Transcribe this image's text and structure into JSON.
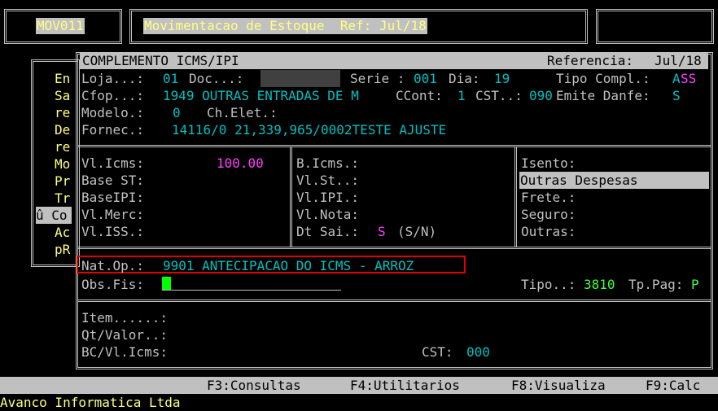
{
  "top": {
    "program_code": "MOV011",
    "title": "Movimentacao de Estoque  Ref: Jul/18"
  },
  "menu": {
    "items": [
      "En",
      "Sa",
      "re",
      "De",
      "re",
      "Mo",
      "Pr",
      "Tr",
      "û Co",
      "Ac",
      "pR"
    ],
    "selected_index": 8
  },
  "panel": {
    "title": "COMPLEMENTO ICMS/IPI",
    "referencia_label": "Referencia:",
    "referencia_value": "Jul/18",
    "loja_label": "Loja...:",
    "loja_value": "01",
    "doc_label": "Doc...:",
    "doc_value": "",
    "serie_label": "Serie :",
    "serie_value": "001",
    "dia_label": "Dia:",
    "dia_value": "19",
    "tipo_compl_label": "Tipo Compl.:",
    "tipo_compl_value_a": "A",
    "tipo_compl_value_b": "SS",
    "cfop_label": "Cfop...:",
    "cfop_value": "1949 OUTRAS ENTRADAS DE M",
    "ccont_label": "CCont:",
    "ccont_value": "1",
    "cst_label": "CST..:",
    "cst_value": "090",
    "emite_label": "Emite Danfe:",
    "emite_value": "S",
    "modelo_label": "Modelo.:",
    "modelo_value": "0",
    "chelet_label": "Ch.Elet.:",
    "fornec_label": "Fornec.:",
    "fornec_value": "14116/0 21,339,965/0002TESTE AJUSTE",
    "col1": {
      "vl_icms_label": "Vl.Icms:",
      "vl_icms_value": "100.00",
      "base_st_label": "Base ST:",
      "baseipi_label": "BaseIPI:",
      "vl_merc_label": "Vl.Merc:",
      "vl_iss_label": "Vl.ISS.:"
    },
    "col2": {
      "b_icms_label": "B.Icms.:",
      "vl_st_label": "Vl.St..:",
      "vl_ipi_label": "Vl.IPI.:",
      "vl_nota_label": "Vl.Nota:",
      "dt_sai_label": "Dt Sai.:",
      "dt_sai_value": "S",
      "dt_sai_hint": "(S/N)"
    },
    "col3": {
      "isento_label": "Isento:",
      "outras_despesas_label": "Outras Despesas",
      "frete_label": "Frete.:",
      "seguro_label": "Seguro:",
      "outras_label": "Outras:"
    },
    "natop_label": "Nat.Op.:",
    "natop_value": "9901 ANTECIPACAO DO ICMS - ARROZ",
    "obs_label": "Obs.Fis:",
    "tipo_label": "Tipo..:",
    "tipo_value": "3810",
    "tppag_label": "Tp.Pag:",
    "tppag_value": "P",
    "item_label": "Item......:",
    "qtvalor_label": "Qt/Valor..:",
    "bcvlicms_label": "BC/Vl.Icms:",
    "cst2_label": "CST:",
    "cst2_value": "000"
  },
  "fkeys": [
    "F3:Consultas",
    "F4:Utilitarios",
    "F8:Visualiza",
    "F9:Calc"
  ],
  "footer": {
    "company": "Avanco Informatica Ltda"
  },
  "colors": {
    "highlight_box": "#e00000",
    "cursor": "#00ff00"
  }
}
